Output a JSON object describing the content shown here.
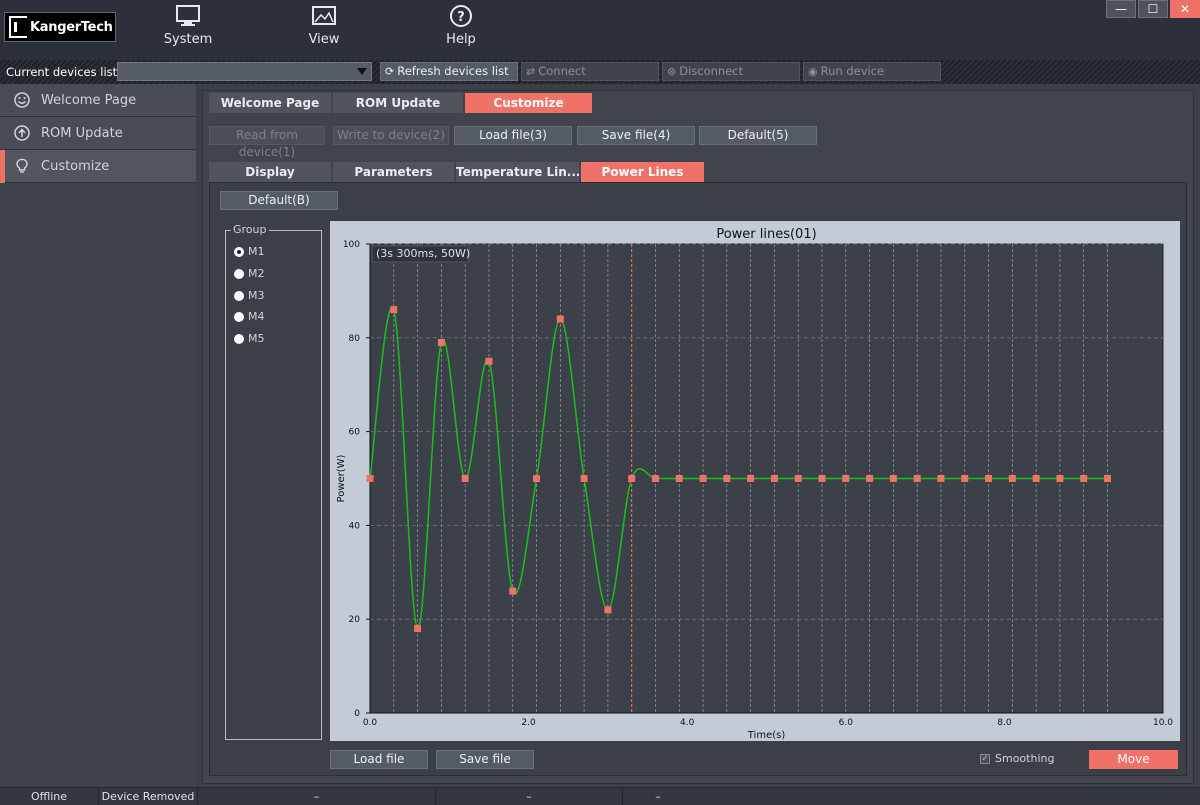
{
  "app": {
    "logo_text": "KangerTech",
    "menus": [
      {
        "label": "System",
        "icon": "monitor-icon"
      },
      {
        "label": "View",
        "icon": "image-icon"
      },
      {
        "label": "Help",
        "icon": "help-icon"
      }
    ],
    "window_controls": {
      "minimize": "—",
      "maximize": "☐",
      "close": "✕"
    }
  },
  "device_bar": {
    "label": "Current devices list",
    "selected_device": "",
    "buttons": [
      {
        "label": "Refresh devices list",
        "icon": "refresh-icon",
        "enabled": true
      },
      {
        "label": "Connect",
        "icon": "connect-icon",
        "enabled": false
      },
      {
        "label": "Disconnect",
        "icon": "disconnect-icon",
        "enabled": false
      },
      {
        "label": "Run device",
        "icon": "run-icon",
        "enabled": false
      }
    ]
  },
  "sidebar": {
    "items": [
      {
        "label": "Welcome Page",
        "icon": "smiley-icon",
        "active": false
      },
      {
        "label": "ROM Update",
        "icon": "upload-icon",
        "active": false
      },
      {
        "label": "Customize",
        "icon": "bulb-icon",
        "active": true
      }
    ]
  },
  "main_tabs": [
    {
      "label": "Welcome Page",
      "active": false
    },
    {
      "label": "ROM Update",
      "active": false
    },
    {
      "label": "Customize",
      "active": true
    }
  ],
  "actions": [
    {
      "label": "Read from device(1)",
      "enabled": false
    },
    {
      "label": "Write to device(2)",
      "enabled": false
    },
    {
      "label": "Load file(3)",
      "enabled": true
    },
    {
      "label": "Save file(4)",
      "enabled": true
    },
    {
      "label": "Default(5)",
      "enabled": true
    }
  ],
  "sub_tabs": [
    {
      "label": "Display",
      "active": false
    },
    {
      "label": "Parameters",
      "active": false
    },
    {
      "label": "Temperature Lin...",
      "active": false
    },
    {
      "label": "Power Lines",
      "active": true
    }
  ],
  "power_lines": {
    "default_button": "Default(B)",
    "group": {
      "title": "Group",
      "options": [
        {
          "label": "M1",
          "checked": true
        },
        {
          "label": "M2",
          "checked": false
        },
        {
          "label": "M3",
          "checked": false
        },
        {
          "label": "M4",
          "checked": false
        },
        {
          "label": "M5",
          "checked": false
        }
      ]
    },
    "load_button": "Load file",
    "save_button": "Save file",
    "smoothing_label": "Smoothing",
    "smoothing_checked": true,
    "move_button": "Move"
  },
  "chart_data": {
    "type": "line",
    "title": "Power lines(01)",
    "xlabel": "Time(s)",
    "ylabel": "Power(W)",
    "xlim": [
      0,
      10
    ],
    "ylim": [
      0,
      100
    ],
    "xticks": [
      0.0,
      2.0,
      4.0,
      6.0,
      8.0,
      10.0
    ],
    "xtick_labels": [
      "0.0",
      "2.0",
      "4.0",
      "6.0",
      "8.0",
      "10.0"
    ],
    "yticks": [
      0,
      20,
      40,
      60,
      80,
      100
    ],
    "ytick_labels": [
      "0",
      "20",
      "40",
      "60",
      "80",
      "100"
    ],
    "grid": true,
    "cursor_x": 3.3,
    "cursor_label": "(3s 300ms, 50W)",
    "series": [
      {
        "color": "#19c019",
        "marker_color": "#f07168",
        "x": [
          0,
          0.3,
          0.6,
          0.9,
          1.2,
          1.5,
          1.8,
          2.1,
          2.4,
          2.7,
          3.0,
          3.3,
          3.6,
          3.9,
          4.2,
          4.5,
          4.8,
          5.1,
          5.4,
          5.7,
          6.0,
          6.3,
          6.6,
          6.9,
          7.2,
          7.5,
          7.8,
          8.1,
          8.4,
          8.7,
          9.0,
          9.3
        ],
        "values": [
          50,
          86,
          18,
          79,
          50,
          75,
          26,
          50,
          84,
          50,
          22,
          50,
          50,
          50,
          50,
          50,
          50,
          50,
          50,
          50,
          50,
          50,
          50,
          50,
          50,
          50,
          50,
          50,
          50,
          50,
          50,
          50
        ]
      }
    ]
  },
  "status_bar": {
    "cells": [
      "Offline",
      "Device Removed",
      "–",
      "–",
      "–"
    ]
  }
}
